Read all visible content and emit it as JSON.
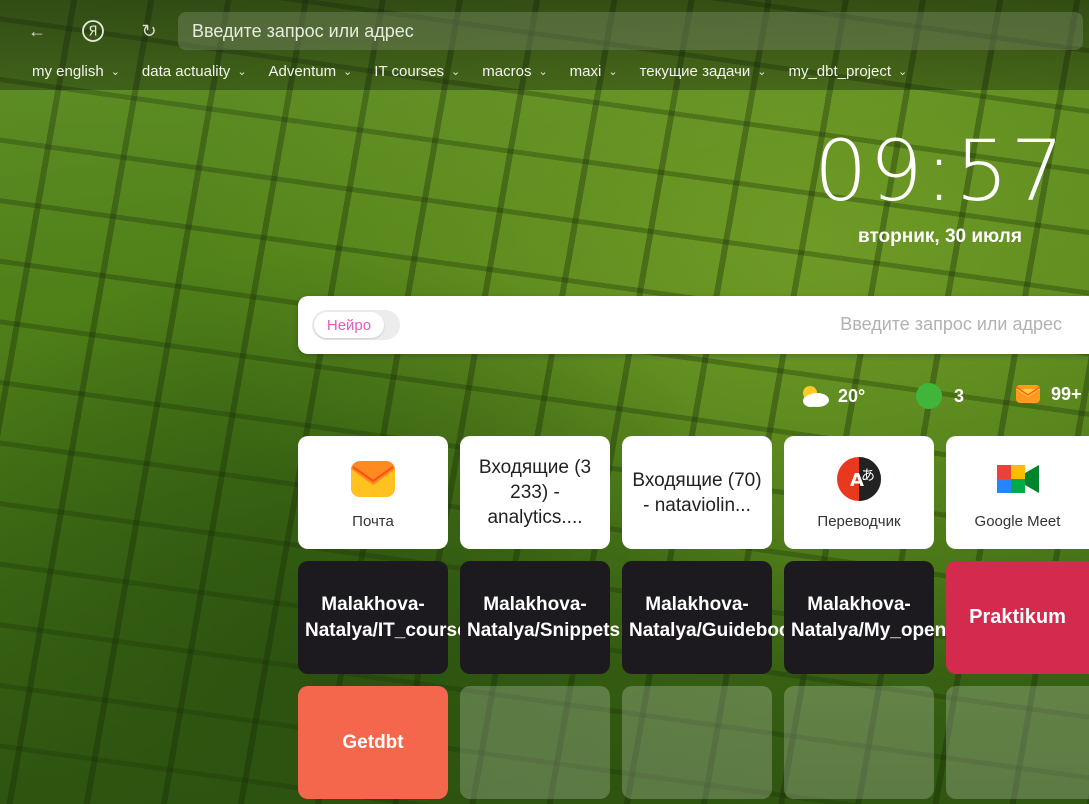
{
  "toolbar": {
    "address_placeholder": "Введите запрос или адрес"
  },
  "bookmarks": [
    {
      "label": "my english"
    },
    {
      "label": "data actuality"
    },
    {
      "label": "Adventum"
    },
    {
      "label": "IT courses"
    },
    {
      "label": "macros"
    },
    {
      "label": "maxi"
    },
    {
      "label": "текущие задачи"
    },
    {
      "label": "my_dbt_project"
    }
  ],
  "clock": {
    "time": "09:57",
    "date": "вторник, 30 июля"
  },
  "search": {
    "neuro_label": "Нейро",
    "placeholder": "Введите запрос или адрес"
  },
  "widgets": {
    "weather": "20°",
    "traffic": "3",
    "mail": "99+"
  },
  "tiles_row1": [
    {
      "label": "Почта"
    },
    {
      "text": "Входящие (3 233) - analytics...."
    },
    {
      "text": "Входящие (70) - nataviolin..."
    },
    {
      "label": "Переводчик"
    },
    {
      "label": "Google Meet"
    }
  ],
  "tiles_row2": [
    {
      "text": "Malakhova-Natalya/IT_courses:..."
    },
    {
      "text": "Malakhova-Natalya/Snippets:..."
    },
    {
      "text": "Malakhova-Natalya/Guidebook:..."
    },
    {
      "text": "Malakhova-Natalya/My_open_tex..."
    },
    {
      "text": "Praktikum"
    }
  ],
  "tiles_row3": [
    {
      "text": "Getdbt"
    }
  ],
  "colors": {
    "praktikum": "#d42a4e",
    "getdbt": "#f4674c",
    "dark_tile": "#1c1a1f",
    "neuro": "#e05bc0"
  }
}
